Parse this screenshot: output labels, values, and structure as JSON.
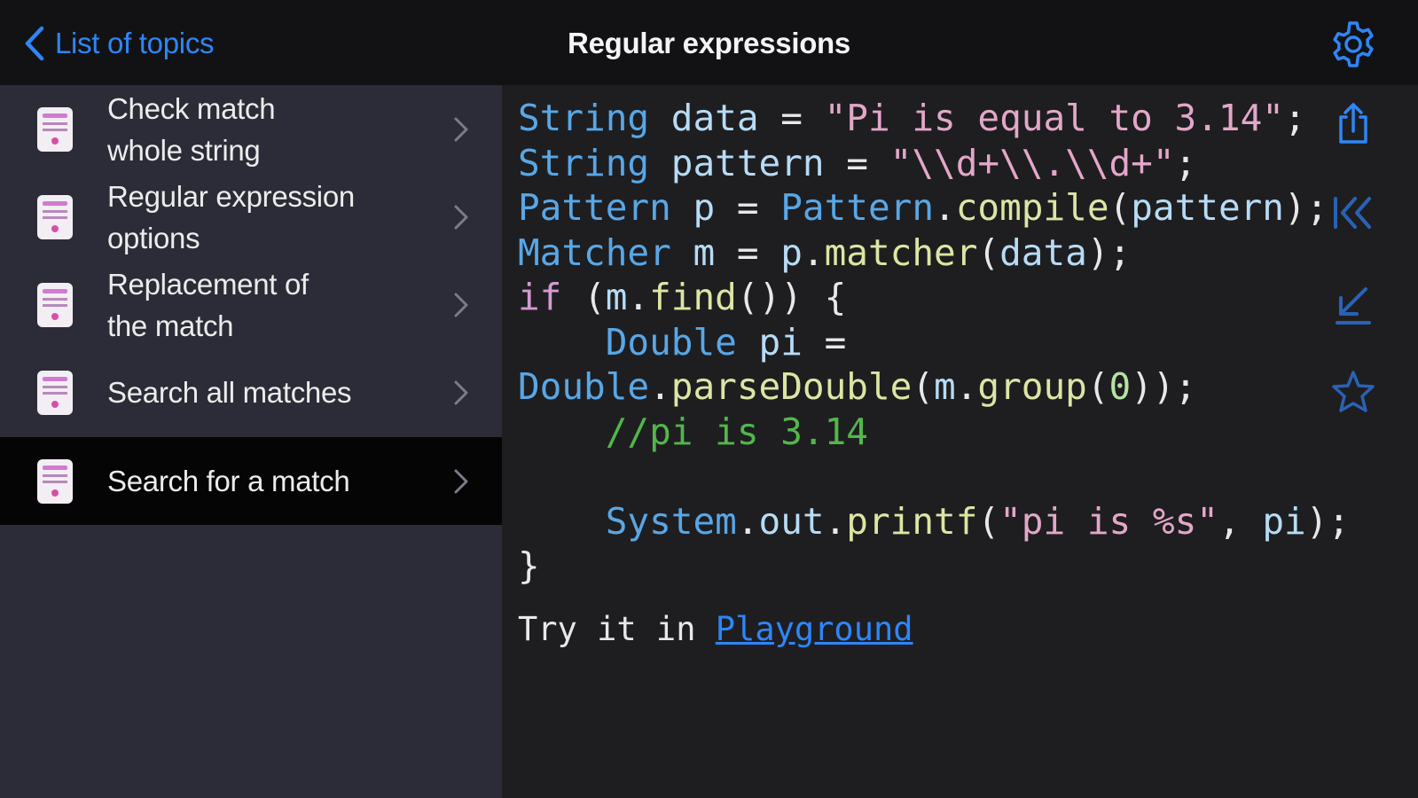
{
  "nav": {
    "back_label": "List of topics",
    "title": "Regular expressions"
  },
  "sidebar": {
    "items": [
      {
        "label_line1": "Check match",
        "label_line2": "whole string",
        "selected": false
      },
      {
        "label_line1": "Regular expression",
        "label_line2": "options",
        "selected": false
      },
      {
        "label_line1": "Replacement of",
        "label_line2": "the match",
        "selected": false
      },
      {
        "label_line1": "Search all matches",
        "label_line2": "",
        "selected": false
      },
      {
        "label_line1": "Search for a match",
        "label_line2": "",
        "selected": true
      }
    ]
  },
  "code": {
    "lines": [
      "String data = \"Pi is equal to 3.14\";",
      "String pattern = \"\\\\d+\\\\.\\\\d+\";",
      "Pattern p = Pattern.compile(pattern);",
      "Matcher m = p.matcher(data);",
      "if (m.find()) {",
      "    Double pi =",
      "Double.parseDouble(m.group(0));",
      "    //pi is 3.14",
      "",
      "    System.out.printf(\"pi is %s\", pi);",
      "}"
    ]
  },
  "footer": {
    "try_text": "Try it in ",
    "playground_link": "Playground"
  },
  "colors": {
    "accent": "#2f86f6",
    "sidebar_bg": "#2b2c37",
    "selected_row_bg": "#050505",
    "code_type": "#59a7e6",
    "code_string": "#e3a7c9",
    "code_comment": "#52b74a"
  },
  "icons": {
    "back": "chevron-left-icon",
    "settings": "gear-icon",
    "row": "code-file-icon",
    "row_disclosure": "chevron-right-icon",
    "share": "share-icon",
    "first": "chevron-double-left-icon",
    "download": "arrow-down-left-icon",
    "favorite": "star-icon"
  }
}
